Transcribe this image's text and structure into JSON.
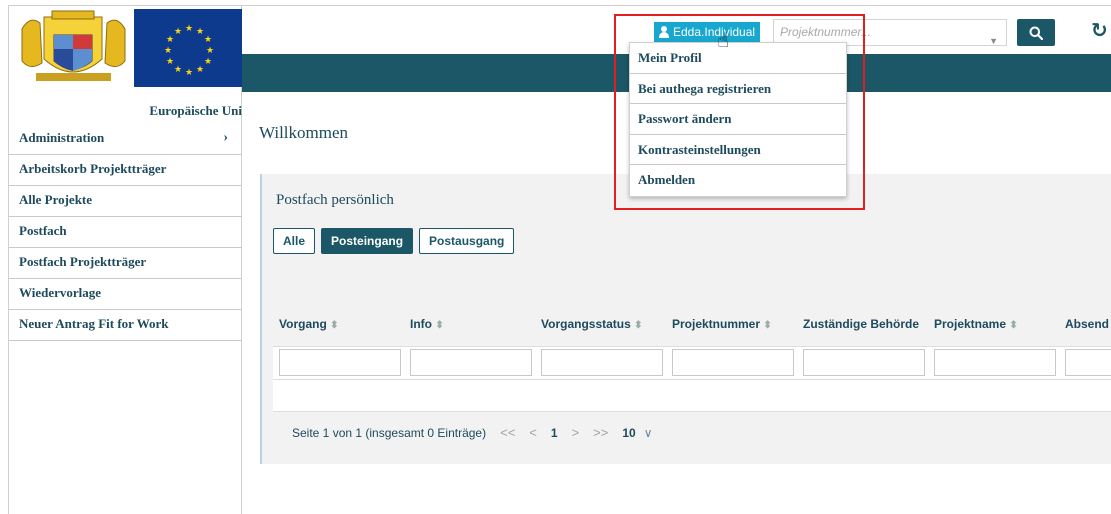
{
  "sidebar": {
    "eu_label": "Europäische Uni",
    "items": [
      {
        "label": "Administration",
        "chevron": "›"
      },
      {
        "label": "Arbeitskorb Projektträger"
      },
      {
        "label": "Alle Projekte"
      },
      {
        "label": "Postfach"
      },
      {
        "label": "Postfach Projektträger"
      },
      {
        "label": "Wiedervorlage"
      },
      {
        "label": "Neuer Antrag Fit for Work"
      }
    ]
  },
  "header": {
    "user_name": "Edda.Individual",
    "search_placeholder": "Projektnummer...",
    "search_icon": "search-icon",
    "refresh_icon": "refresh-icon"
  },
  "user_menu": {
    "items": [
      {
        "label": "Mein Profil"
      },
      {
        "label": "Bei authega registrieren"
      },
      {
        "label": "Passwort ändern"
      },
      {
        "label": "Kontrasteinstellungen"
      },
      {
        "label": "Abmelden"
      }
    ],
    "highlight_color": "#e02020"
  },
  "main": {
    "welcome": "Willkommen",
    "card_title": "Postfach persönlich",
    "filters": [
      {
        "label": "Alle"
      },
      {
        "label": "Posteingang",
        "active": true
      },
      {
        "label": "Postausgang"
      }
    ],
    "columns": [
      {
        "label": "Vorgang",
        "sort": "⬍"
      },
      {
        "label": "Info",
        "sort": "⬍"
      },
      {
        "label": "Vorgangsstatus",
        "sort": "⬍"
      },
      {
        "label": "Projektnummer",
        "sort": "⬍"
      },
      {
        "label": "Zuständige Behörde",
        "sort": ""
      },
      {
        "label": "Projektname",
        "sort": "⬍"
      },
      {
        "label": "Absend",
        "sort": ""
      }
    ],
    "pager": {
      "summary": "Seite 1 von 1 (insgesamt 0 Einträge)",
      "first": "<<",
      "prev": "<",
      "current_page": "1",
      "next": ">",
      "last": ">>",
      "page_size": "10",
      "page_size_caret": "∨"
    }
  },
  "colors": {
    "brand_teal": "#1b5766",
    "user_button": "#18a7cf",
    "text": "#1d4a5c"
  }
}
